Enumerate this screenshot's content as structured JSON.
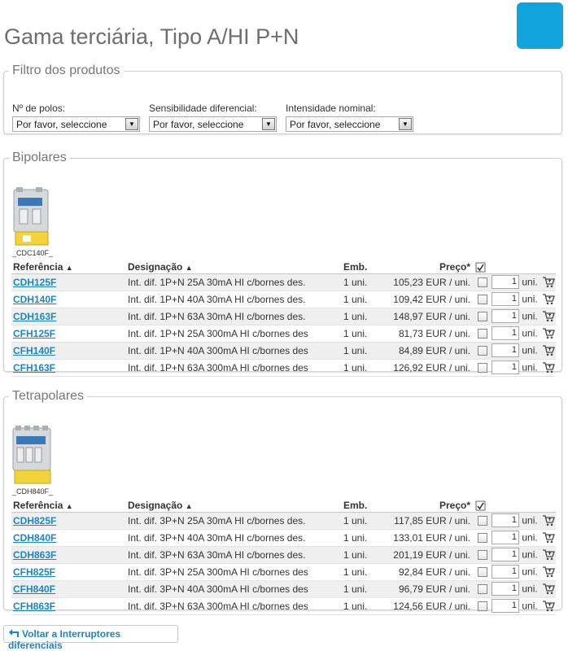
{
  "page": {
    "title": "Gama terciária, Tipo A/HI P+N",
    "brand_color": "#10a3dc",
    "link_color": "#1a86c6"
  },
  "filter": {
    "legend": "Filtro dos produtos",
    "groups": [
      {
        "label": "Nº de polos:",
        "selected": "Por favor, seleccione"
      },
      {
        "label": "Sensibilidade diferencial:",
        "selected": "Por favor, seleccione"
      },
      {
        "label": "Intensidade nominal:",
        "selected": "Por favor, seleccione"
      }
    ]
  },
  "columns": {
    "ref": "Referência",
    "des": "Designação",
    "emb": "Emb.",
    "price": "Preço*"
  },
  "sections": [
    {
      "legend": "Bipolares",
      "image_caption": "_CDC140F_",
      "rows": [
        {
          "ref": "CDH125F",
          "des": "Int. dif. 1P+N 25A 30mA HI c/bornes des.",
          "emb": "1 uni.",
          "price": "105,23 EUR / uni.",
          "qty": "1",
          "unit": "uni."
        },
        {
          "ref": "CDH140F",
          "des": "Int. dif. 1P+N 40A 30mA HI c/bornes des.",
          "emb": "1 uni.",
          "price": "109,42 EUR / uni.",
          "qty": "1",
          "unit": "uni."
        },
        {
          "ref": "CDH163F",
          "des": "Int. dif. 1P+N 63A 30mA HI c/bornes des.",
          "emb": "1 uni.",
          "price": "148,97 EUR / uni.",
          "qty": "1",
          "unit": "uni."
        },
        {
          "ref": "CFH125F",
          "des": "Int. dif. 1P+N 25A 300mA HI c/bornes des",
          "emb": "1 uni.",
          "price": "81,73 EUR / uni.",
          "qty": "1",
          "unit": "uni."
        },
        {
          "ref": "CFH140F",
          "des": "Int. dif. 1P+N 40A 300mA HI c/bornes des",
          "emb": "1 uni.",
          "price": "84,89 EUR / uni.",
          "qty": "1",
          "unit": "uni."
        },
        {
          "ref": "CFH163F",
          "des": "Int. dif. 1P+N 63A 300mA HI c/bornes des",
          "emb": "1 uni.",
          "price": "126,92 EUR / uni.",
          "qty": "1",
          "unit": "uni."
        }
      ]
    },
    {
      "legend": "Tetrapolares",
      "image_caption": "_CDH840F_",
      "rows": [
        {
          "ref": "CDH825F",
          "des": "Int. dif. 3P+N 25A 30mA HI c/bornes des.",
          "emb": "1 uni.",
          "price": "117,85 EUR / uni.",
          "qty": "1",
          "unit": "uni."
        },
        {
          "ref": "CDH840F",
          "des": "Int. dif. 3P+N 40A 30mA HI c/bornes des.",
          "emb": "1 uni.",
          "price": "133,01 EUR / uni.",
          "qty": "1",
          "unit": "uni."
        },
        {
          "ref": "CDH863F",
          "des": "Int. dif. 3P+N 63A 30mA HI c/bornes des.",
          "emb": "1 uni.",
          "price": "201,19 EUR / uni.",
          "qty": "1",
          "unit": "uni."
        },
        {
          "ref": "CFH825F",
          "des": "Int. dif. 3P+N 25A 300mA HI c/bornes des",
          "emb": "1 uni.",
          "price": "92,84 EUR / uni.",
          "qty": "1",
          "unit": "uni."
        },
        {
          "ref": "CFH840F",
          "des": "Int. dif. 3P+N 40A 300mA HI c/bornes des",
          "emb": "1 uni.",
          "price": "96,79 EUR / uni.",
          "qty": "1",
          "unit": "uni."
        },
        {
          "ref": "CFH863F",
          "des": "Int. dif. 3P+N 63A 300mA HI c/bornes des",
          "emb": "1 uni.",
          "price": "124,56 EUR / uni.",
          "qty": "1",
          "unit": "uni."
        }
      ]
    }
  ],
  "back": {
    "label": "Voltar a Interruptores diferenciais",
    "icon": "back-arrow-icon"
  },
  "icons": {
    "header_select_all": "select-all-icon",
    "row_cart": "add-to-cart-icon",
    "sort": "sort-asc-icon"
  }
}
